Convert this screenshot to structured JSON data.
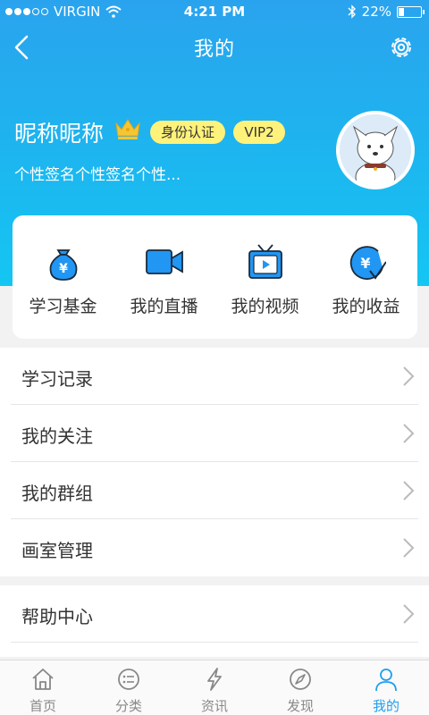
{
  "status_bar": {
    "carrier": "VIRGIN",
    "time": "4:21 PM",
    "battery": "22%",
    "battery_level": 0.22
  },
  "nav": {
    "title": "我的"
  },
  "profile": {
    "nickname": "昵称昵称",
    "badges": {
      "identity": "身份认证",
      "vip": "VIP2"
    },
    "signature": "个性签名个性签名个性..."
  },
  "quick_actions": [
    {
      "label": "学习基金",
      "icon": "money-bag-icon"
    },
    {
      "label": "我的直播",
      "icon": "video-camera-icon"
    },
    {
      "label": "我的视频",
      "icon": "tv-play-icon"
    },
    {
      "label": "我的收益",
      "icon": "income-icon"
    }
  ],
  "menu_group1": [
    {
      "label": "学习记录"
    },
    {
      "label": "我的关注"
    },
    {
      "label": "我的群组"
    },
    {
      "label": "画室管理"
    }
  ],
  "menu_group2": [
    {
      "label": "帮助中心"
    }
  ],
  "tabs": [
    {
      "label": "首页",
      "icon": "home-icon"
    },
    {
      "label": "分类",
      "icon": "category-icon"
    },
    {
      "label": "资讯",
      "icon": "lightning-icon"
    },
    {
      "label": "发现",
      "icon": "compass-icon"
    },
    {
      "label": "我的",
      "icon": "user-icon",
      "active": true
    }
  ],
  "colors": {
    "accent": "#1e9ff0",
    "badge": "#fff27a",
    "icon_blue": "#2196f3",
    "icon_dark": "#1a2b3c"
  }
}
